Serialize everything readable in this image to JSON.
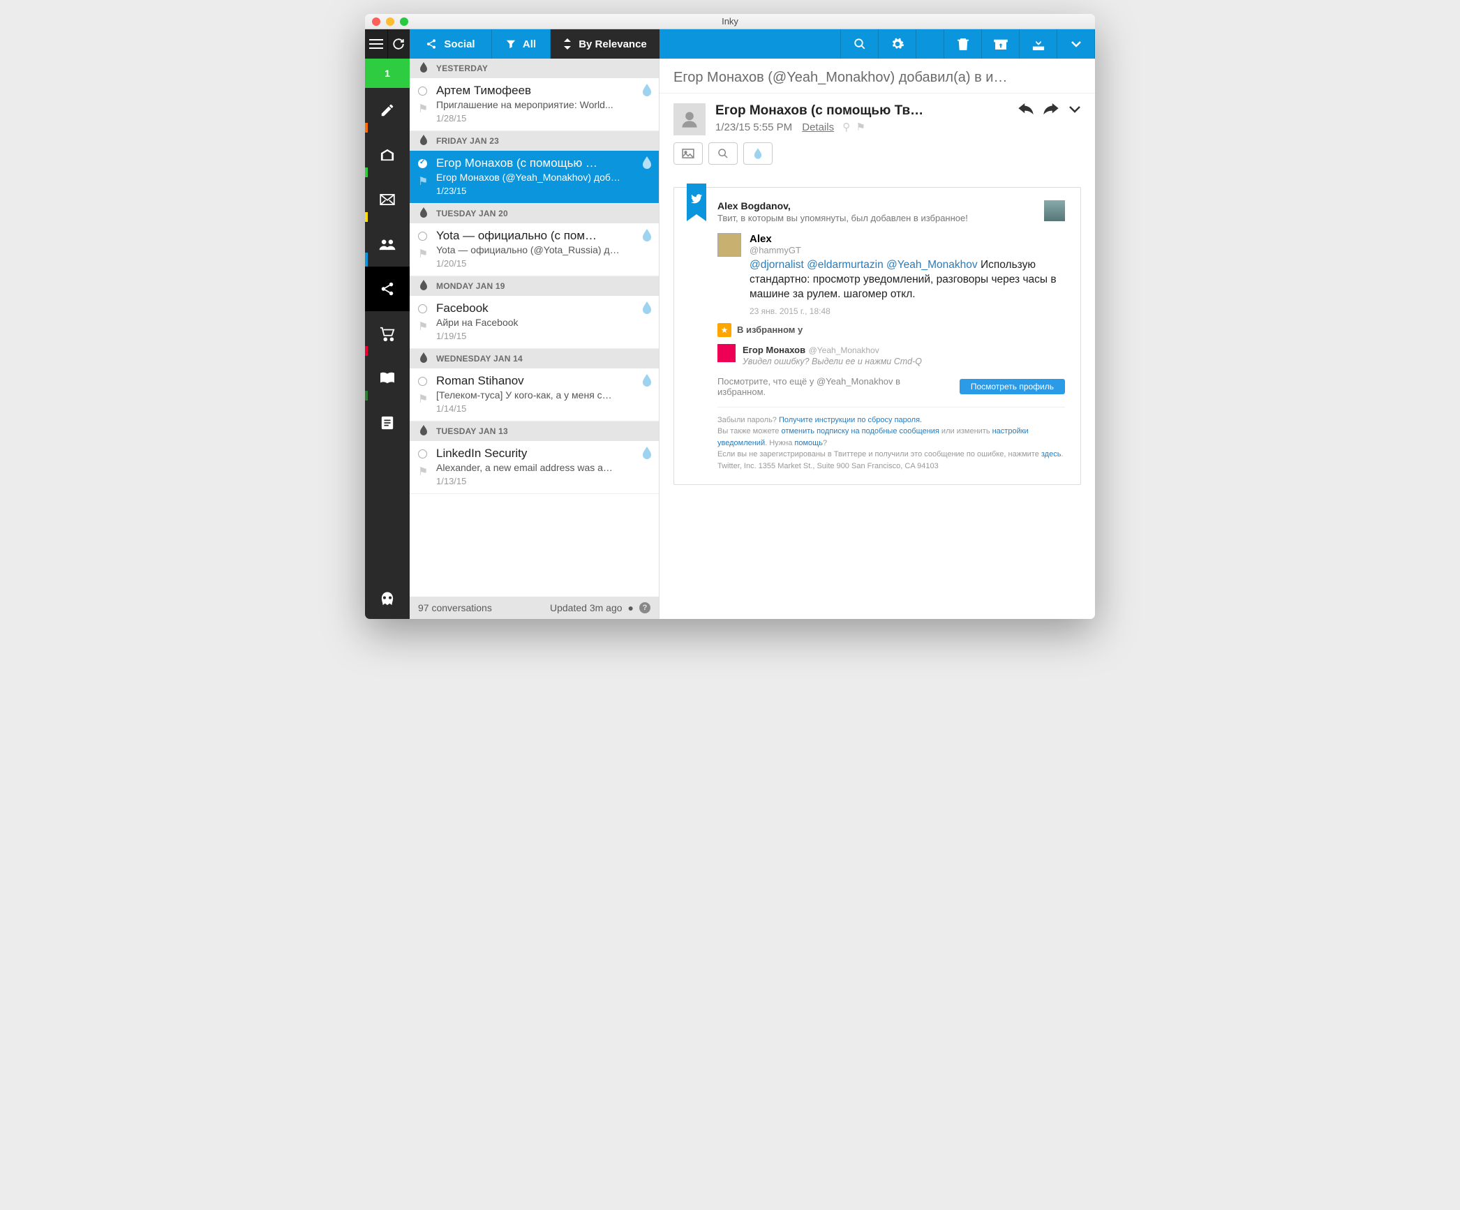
{
  "window": {
    "title": "Inky"
  },
  "rail": {
    "badge": "1"
  },
  "toolbar": {
    "social": "Social",
    "all": "All",
    "sort": "By Relevance"
  },
  "groups": [
    {
      "header": "YESTERDAY",
      "messages": [
        {
          "from": "Артем Тимофеев",
          "subject": "Приглашение на мероприятие: World...",
          "date": "1/28/15"
        }
      ]
    },
    {
      "header": "FRIDAY JAN 23",
      "messages": [
        {
          "from": "Егор Монахов (с помощью …",
          "subject": "Егор Монахов (@Yeah_Monakhov) доб…",
          "date": "1/23/15",
          "selected": true
        }
      ]
    },
    {
      "header": "TUESDAY JAN 20",
      "messages": [
        {
          "from": "Yota — официально (с пом…",
          "subject": "Yota — официально (@Yota_Russia) д…",
          "date": "1/20/15"
        }
      ]
    },
    {
      "header": "MONDAY JAN 19",
      "messages": [
        {
          "from": "Facebook",
          "subject": "Айри на Facebook",
          "date": "1/19/15"
        }
      ]
    },
    {
      "header": "WEDNESDAY JAN 14",
      "messages": [
        {
          "from": "Roman Stihanov",
          "subject": "[Телеком-туса] У кого-как, а у меня с…",
          "date": "1/14/15"
        }
      ]
    },
    {
      "header": "TUESDAY JAN 13",
      "messages": [
        {
          "from": "LinkedIn Security",
          "subject": "Alexander, a new email address was a…",
          "date": "1/13/15"
        }
      ]
    }
  ],
  "footer": {
    "count": "97 conversations",
    "updated": "Updated 3m ago"
  },
  "reader": {
    "subject": "Егор Монахов (@Yeah_Monakhov) добавил(а) в и…",
    "from": "Егор Монахов (с помощью Тв…",
    "timestamp": "1/23/15 5:55 PM",
    "details": "Details"
  },
  "tweetcard": {
    "recipient": "Alex Bogdanov,",
    "intro": "Твит, в которым вы упомянуты, был добавлен в избранное!",
    "author": "Alex",
    "handle": "@hammyGT",
    "mentions": "@djornalist @eldarmurtazin @Yeah_Monakhov",
    "body": "Использую стандартно: просмотр уведомлений, разговоры через часы в машине за рулем. шагомер откл.",
    "date": "23 янв. 2015 г., 18:48",
    "fav_label": "В избранном у",
    "faver_name": "Егор Монахов",
    "faver_handle": "@Yeah_Monakhov",
    "faver_bio": "Увидел ошибку? Выдели ее и нажми Cmd-Q",
    "seemore": "Посмотрите, что ещё у @Yeah_Monakhov в избранном.",
    "profile_btn": "Посмотреть профиль",
    "fine1a": "Забыли пароль? ",
    "fine1b": "Получите инструкции по сбросу пароля.",
    "fine2a": "Вы также можете ",
    "fine2b": "отменить подписку на подобные сообщения",
    "fine2c": " или изменить ",
    "fine2d": "настройки уведомлений",
    "fine2e": ". Нужна ",
    "fine2f": "помощь",
    "fine2g": "?",
    "fine3a": "Если вы не зарегистрированы в Твиттере и получили это сообщение по ошибке, нажмите ",
    "fine3b": "здесь",
    "fine3c": ".",
    "fine4": "Twitter, Inc. 1355 Market St., Suite 900 San Francisco, CA 94103"
  }
}
